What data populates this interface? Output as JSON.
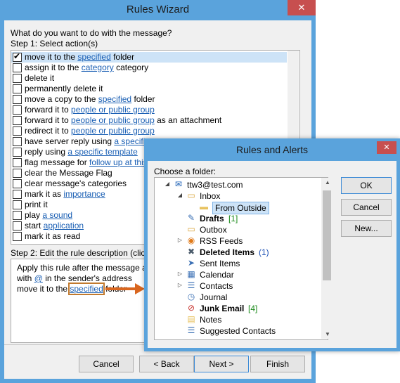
{
  "wizard": {
    "title": "Rules Wizard",
    "close_glyph": "✕",
    "question": "What do you want to do with the message?",
    "step1": "Step 1: Select action(s)",
    "actions": [
      {
        "checked": true,
        "selected": true,
        "pre": "move it to the ",
        "link": "specified",
        "post": " folder"
      },
      {
        "checked": false,
        "pre": "assign it to the ",
        "link": "category",
        "post": " category"
      },
      {
        "checked": false,
        "pre": "delete it",
        "link": "",
        "post": ""
      },
      {
        "checked": false,
        "pre": "permanently delete it",
        "link": "",
        "post": ""
      },
      {
        "checked": false,
        "pre": "move a copy to the ",
        "link": "specified",
        "post": " folder"
      },
      {
        "checked": false,
        "pre": "forward it to ",
        "link": "people or public group",
        "post": ""
      },
      {
        "checked": false,
        "pre": "forward it to ",
        "link": "people or public group",
        "post": " as an attachment"
      },
      {
        "checked": false,
        "pre": "redirect it to ",
        "link": "people or public group",
        "post": ""
      },
      {
        "checked": false,
        "pre": "have server reply using ",
        "link": "a specific",
        "post": ""
      },
      {
        "checked": false,
        "pre": "reply using ",
        "link": "a specific template",
        "post": ""
      },
      {
        "checked": false,
        "pre": "flag message for ",
        "link": "follow up at this",
        "post": ""
      },
      {
        "checked": false,
        "pre": "clear the Message Flag",
        "link": "",
        "post": ""
      },
      {
        "checked": false,
        "pre": "clear message's categories",
        "link": "",
        "post": ""
      },
      {
        "checked": false,
        "pre": "mark it as ",
        "link": "importance",
        "post": ""
      },
      {
        "checked": false,
        "pre": "print it",
        "link": "",
        "post": ""
      },
      {
        "checked": false,
        "pre": "play ",
        "link": "a sound",
        "post": ""
      },
      {
        "checked": false,
        "pre": "start ",
        "link": "application",
        "post": ""
      },
      {
        "checked": false,
        "pre": "mark it as read",
        "link": "",
        "post": ""
      }
    ],
    "step2": "Step 2: Edit the rule description (click",
    "desc_line1": "Apply this rule after the message ar",
    "desc_line2_pre": "with ",
    "desc_line2_link": "@",
    "desc_line2_post": " in the sender's address",
    "desc_line3_pre": "move it to the ",
    "desc_line3_link": "specified",
    "desc_line3_post": " folder",
    "buttons": {
      "cancel": "Cancel",
      "back": "< Back",
      "next": "Next >",
      "finish": "Finish"
    }
  },
  "dialog": {
    "title": "Rules and Alerts",
    "close_glyph": "✕",
    "choose_label": "Choose a folder:",
    "buttons": {
      "ok": "OK",
      "cancel": "Cancel",
      "new": "New..."
    },
    "tree": [
      {
        "label": "ttw3@test.com",
        "icon": "account-icon",
        "glyph": "✉",
        "color": "#1a5fb4",
        "bold": false,
        "count": "",
        "count_class": "",
        "expander": "◢",
        "level": 0
      },
      {
        "label": "Inbox",
        "icon": "inbox-icon",
        "glyph": "▭",
        "color": "#d9a43a",
        "bold": false,
        "count": "",
        "count_class": "",
        "expander": "◢",
        "level": 1
      },
      {
        "label": "From Outside",
        "icon": "folder-icon",
        "glyph": "▬",
        "color": "#e8c25e",
        "bold": false,
        "count": "",
        "count_class": "",
        "expander": "",
        "level": 2,
        "selected": true
      },
      {
        "label": "Drafts",
        "icon": "drafts-icon",
        "glyph": "✎",
        "color": "#3a6fb4",
        "bold": true,
        "count": "[1]",
        "count_class": "green",
        "expander": "",
        "level": 1
      },
      {
        "label": "Outbox",
        "icon": "outbox-icon",
        "glyph": "▭",
        "color": "#d9a43a",
        "bold": false,
        "count": "",
        "count_class": "",
        "expander": "",
        "level": 1
      },
      {
        "label": "RSS Feeds",
        "icon": "rss-icon",
        "glyph": "◉",
        "color": "#e07a1a",
        "bold": false,
        "count": "",
        "count_class": "",
        "expander": "▷",
        "level": 1
      },
      {
        "label": "Deleted Items",
        "icon": "trash-icon",
        "glyph": "✖",
        "color": "#4a5a6a",
        "bold": true,
        "count": "(1)",
        "count_class": "blue",
        "expander": "",
        "level": 1
      },
      {
        "label": "Sent Items",
        "icon": "sent-icon",
        "glyph": "➤",
        "color": "#3a6fb4",
        "bold": false,
        "count": "",
        "count_class": "",
        "expander": "",
        "level": 1
      },
      {
        "label": "Calendar",
        "icon": "calendar-icon",
        "glyph": "▦",
        "color": "#3a6fb4",
        "bold": false,
        "count": "",
        "count_class": "",
        "expander": "▷",
        "level": 1
      },
      {
        "label": "Contacts",
        "icon": "contacts-icon",
        "glyph": "☰",
        "color": "#3a6fb4",
        "bold": false,
        "count": "",
        "count_class": "",
        "expander": "▷",
        "level": 1
      },
      {
        "label": "Journal",
        "icon": "journal-icon",
        "glyph": "◷",
        "color": "#3a6fb4",
        "bold": false,
        "count": "",
        "count_class": "",
        "expander": "",
        "level": 1
      },
      {
        "label": "Junk Email",
        "icon": "junk-icon",
        "glyph": "⊘",
        "color": "#c7302b",
        "bold": true,
        "count": "[4]",
        "count_class": "green",
        "expander": "",
        "level": 1
      },
      {
        "label": "Notes",
        "icon": "notes-icon",
        "glyph": "▤",
        "color": "#e8c25e",
        "bold": false,
        "count": "",
        "count_class": "",
        "expander": "",
        "level": 1
      },
      {
        "label": "Suggested Contacts",
        "icon": "contacts-icon",
        "glyph": "☰",
        "color": "#3a6fb4",
        "bold": false,
        "count": "",
        "count_class": "",
        "expander": "",
        "level": 1
      }
    ]
  }
}
